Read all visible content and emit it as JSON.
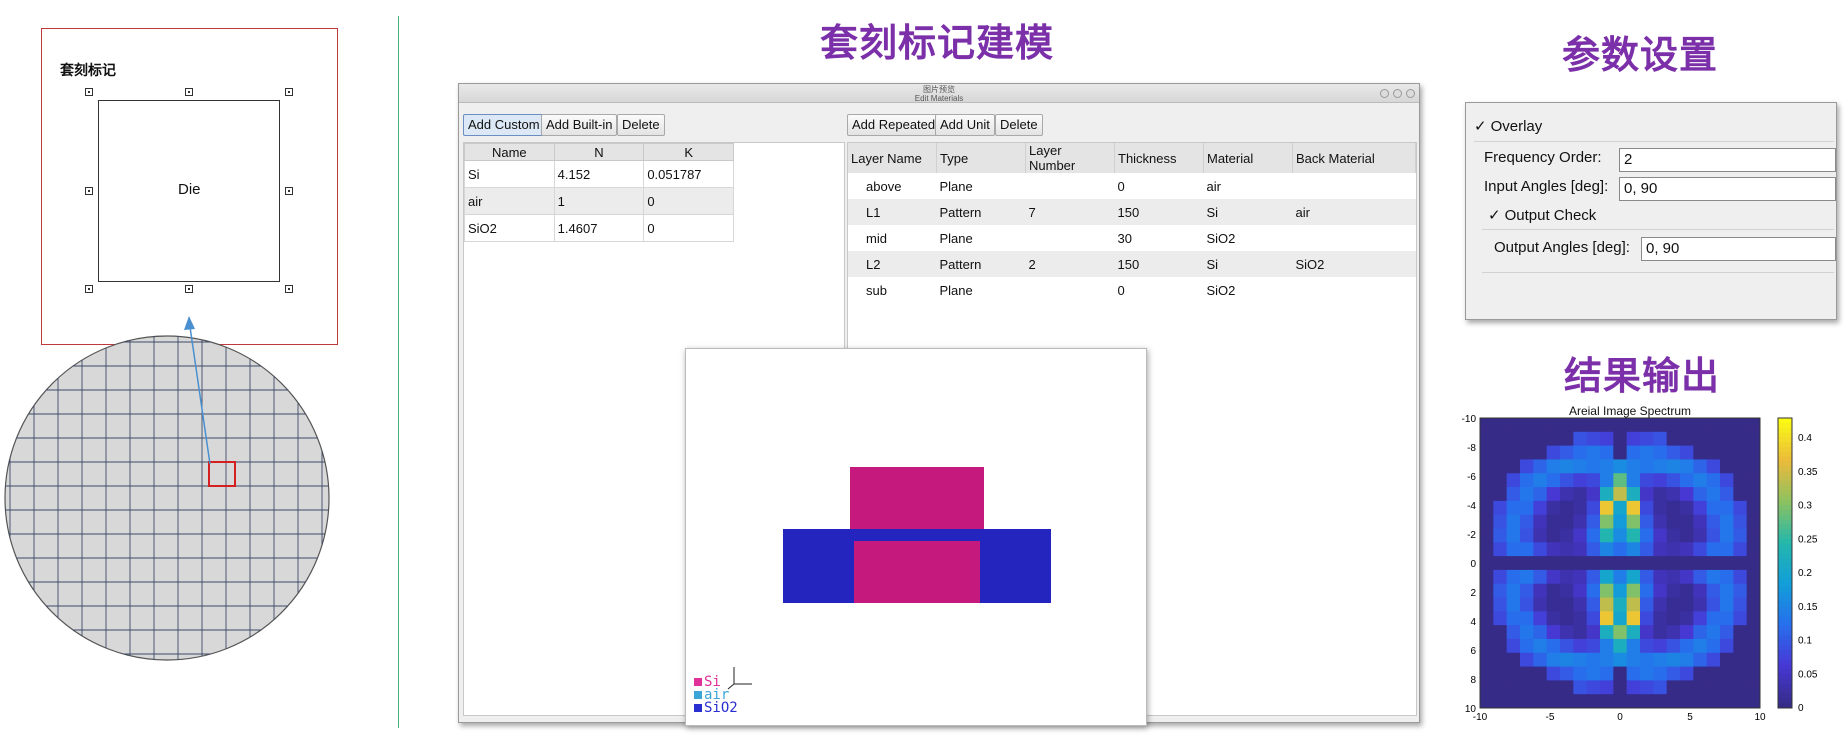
{
  "titles": {
    "modeling": "套刻标记建模",
    "params": "参数设置",
    "results": "结果输出"
  },
  "left_panel": {
    "mark_label": "套刻标记",
    "die_label": "Die"
  },
  "window": {
    "title_top": "图片预览",
    "title_sub": "Edit Materials",
    "material_buttons": [
      "Add Custom",
      "Add Built-in",
      "Delete"
    ],
    "layer_buttons": [
      "Add Repeated",
      "Add Unit",
      "Delete"
    ],
    "material_columns": [
      "Name",
      "N",
      "K"
    ],
    "materials": [
      {
        "name": "Si",
        "n": "4.152",
        "k": "0.051787"
      },
      {
        "name": "air",
        "n": "1",
        "k": "0"
      },
      {
        "name": "SiO2",
        "n": "1.4607",
        "k": "0"
      }
    ],
    "layer_columns": [
      "Layer Name",
      "Type",
      "Layer Number",
      "Thickness",
      "Material",
      "Back Material"
    ],
    "layers": [
      {
        "name": "above",
        "type": "Plane",
        "number": "",
        "thickness": "0",
        "material": "air",
        "back": ""
      },
      {
        "name": "L1",
        "type": "Pattern",
        "number": "7",
        "thickness": "150",
        "material": "Si",
        "back": "air"
      },
      {
        "name": "mid",
        "type": "Plane",
        "number": "",
        "thickness": "30",
        "material": "SiO2",
        "back": ""
      },
      {
        "name": "L2",
        "type": "Pattern",
        "number": "2",
        "thickness": "150",
        "material": "Si",
        "back": "SiO2"
      },
      {
        "name": "sub",
        "type": "Plane",
        "number": "",
        "thickness": "0",
        "material": "SiO2",
        "back": ""
      }
    ]
  },
  "preview": {
    "legend": [
      {
        "label": "Si",
        "color": "#e0309a"
      },
      {
        "label": "air",
        "color": "#3aa6d8"
      },
      {
        "label": "SiO2",
        "color": "#2a2fd0"
      }
    ],
    "colors": {
      "si": "#c5197d",
      "sio2": "#2424be"
    }
  },
  "settings": {
    "overlay_label": "Overlay",
    "frequency_label": "Frequency Order:",
    "frequency_value": "2",
    "input_angles_label": "Input Angles [deg]:",
    "input_angles_value": "0, 90",
    "output_check_label": "Output Check",
    "output_angles_label": "Output Angles [deg]:",
    "output_angles_value": "0, 90"
  },
  "chart_data": {
    "type": "heatmap",
    "title": "Areial Image Spectrum",
    "x_ticks": [
      "-10",
      "-5",
      "0",
      "5",
      "10"
    ],
    "y_ticks": [
      "-10",
      "-8",
      "-6",
      "-4",
      "-2",
      "0",
      "2",
      "4",
      "6",
      "8",
      "10"
    ],
    "colorbar_ticks": [
      "0.4",
      "0.35",
      "0.3",
      "0.25",
      "0.2",
      "0.15",
      "0.1",
      "0.05",
      "0"
    ],
    "xlim": [
      -10,
      10
    ],
    "ylim": [
      -10,
      10
    ],
    "clim": [
      0,
      0.43
    ],
    "colormap": "parula",
    "grid": [
      [
        0,
        0,
        0,
        0,
        0,
        0,
        0,
        0,
        0,
        0,
        0,
        0,
        0,
        0,
        0,
        0,
        0,
        0,
        0,
        0,
        0
      ],
      [
        0,
        0,
        0,
        0,
        0,
        0,
        0,
        0.09,
        0.08,
        0.07,
        0,
        0.07,
        0.08,
        0.09,
        0,
        0,
        0,
        0,
        0,
        0,
        0
      ],
      [
        0,
        0,
        0,
        0,
        0,
        0.08,
        0.1,
        0.12,
        0.13,
        0.12,
        0,
        0.12,
        0.13,
        0.12,
        0.1,
        0.08,
        0,
        0,
        0,
        0,
        0
      ],
      [
        0,
        0,
        0,
        0.08,
        0.11,
        0.14,
        0.15,
        0.14,
        0.13,
        0.14,
        0.16,
        0.14,
        0.13,
        0.14,
        0.15,
        0.14,
        0.11,
        0.08,
        0,
        0,
        0
      ],
      [
        0,
        0,
        0.08,
        0.12,
        0.14,
        0.12,
        0.09,
        0.07,
        0.08,
        0.14,
        0.28,
        0.14,
        0.08,
        0.07,
        0.09,
        0.12,
        0.14,
        0.12,
        0.08,
        0,
        0
      ],
      [
        0,
        0,
        0.1,
        0.13,
        0.11,
        0.06,
        0.03,
        0.02,
        0.05,
        0.22,
        0.34,
        0.22,
        0.05,
        0.02,
        0.03,
        0.06,
        0.11,
        0.13,
        0.1,
        0,
        0
      ],
      [
        0,
        0.08,
        0.12,
        0.12,
        0.07,
        0.02,
        0.01,
        0.02,
        0.08,
        0.38,
        0.2,
        0.38,
        0.08,
        0.02,
        0.01,
        0.02,
        0.07,
        0.12,
        0.12,
        0.08,
        0
      ],
      [
        0,
        0.09,
        0.13,
        0.1,
        0.04,
        0.01,
        0.01,
        0.03,
        0.1,
        0.3,
        0.18,
        0.3,
        0.1,
        0.03,
        0.01,
        0.01,
        0.04,
        0.1,
        0.13,
        0.09,
        0
      ],
      [
        0,
        0.1,
        0.13,
        0.09,
        0.03,
        0.01,
        0.02,
        0.05,
        0.12,
        0.24,
        0.16,
        0.24,
        0.12,
        0.05,
        0.02,
        0.01,
        0.03,
        0.09,
        0.13,
        0.1,
        0
      ],
      [
        0,
        0.08,
        0.12,
        0.12,
        0.08,
        0.04,
        0.03,
        0.04,
        0.1,
        0.15,
        0.12,
        0.15,
        0.1,
        0.04,
        0.03,
        0.04,
        0.08,
        0.12,
        0.12,
        0.08,
        0
      ],
      [
        0,
        0,
        0,
        0,
        0,
        0,
        0,
        0,
        0,
        0,
        0,
        0,
        0,
        0,
        0,
        0,
        0,
        0,
        0,
        0,
        0
      ],
      [
        0,
        0.08,
        0.12,
        0.13,
        0.1,
        0.05,
        0.03,
        0.04,
        0.1,
        0.2,
        0.14,
        0.2,
        0.1,
        0.04,
        0.03,
        0.05,
        0.1,
        0.13,
        0.12,
        0.08,
        0
      ],
      [
        0,
        0.1,
        0.13,
        0.1,
        0.04,
        0.01,
        0.02,
        0.05,
        0.12,
        0.3,
        0.18,
        0.3,
        0.12,
        0.05,
        0.02,
        0.01,
        0.04,
        0.1,
        0.13,
        0.1,
        0
      ],
      [
        0,
        0.09,
        0.13,
        0.09,
        0.03,
        0.01,
        0.01,
        0.03,
        0.1,
        0.34,
        0.22,
        0.34,
        0.1,
        0.03,
        0.01,
        0.01,
        0.03,
        0.09,
        0.13,
        0.09,
        0
      ],
      [
        0,
        0.08,
        0.12,
        0.12,
        0.07,
        0.02,
        0.01,
        0.02,
        0.08,
        0.38,
        0.2,
        0.38,
        0.08,
        0.02,
        0.01,
        0.02,
        0.07,
        0.12,
        0.12,
        0.08,
        0
      ],
      [
        0,
        0,
        0.1,
        0.13,
        0.11,
        0.06,
        0.03,
        0.02,
        0.05,
        0.22,
        0.3,
        0.22,
        0.05,
        0.02,
        0.03,
        0.06,
        0.11,
        0.13,
        0.1,
        0,
        0
      ],
      [
        0,
        0,
        0.08,
        0.12,
        0.14,
        0.12,
        0.09,
        0.07,
        0.08,
        0.14,
        0.22,
        0.14,
        0.08,
        0.07,
        0.09,
        0.12,
        0.14,
        0.12,
        0.08,
        0,
        0
      ],
      [
        0,
        0,
        0,
        0.08,
        0.11,
        0.14,
        0.15,
        0.14,
        0.13,
        0.14,
        0.16,
        0.14,
        0.13,
        0.14,
        0.15,
        0.14,
        0.11,
        0.08,
        0,
        0,
        0
      ],
      [
        0,
        0,
        0,
        0,
        0,
        0.08,
        0.1,
        0.12,
        0.13,
        0.12,
        0,
        0.12,
        0.13,
        0.12,
        0.1,
        0.08,
        0,
        0,
        0,
        0,
        0
      ],
      [
        0,
        0,
        0,
        0,
        0,
        0,
        0,
        0.09,
        0.08,
        0.07,
        0,
        0.07,
        0.08,
        0.09,
        0,
        0,
        0,
        0,
        0,
        0,
        0
      ],
      [
        0,
        0,
        0,
        0,
        0,
        0,
        0,
        0,
        0,
        0,
        0,
        0,
        0,
        0,
        0,
        0,
        0,
        0,
        0,
        0,
        0
      ]
    ]
  }
}
